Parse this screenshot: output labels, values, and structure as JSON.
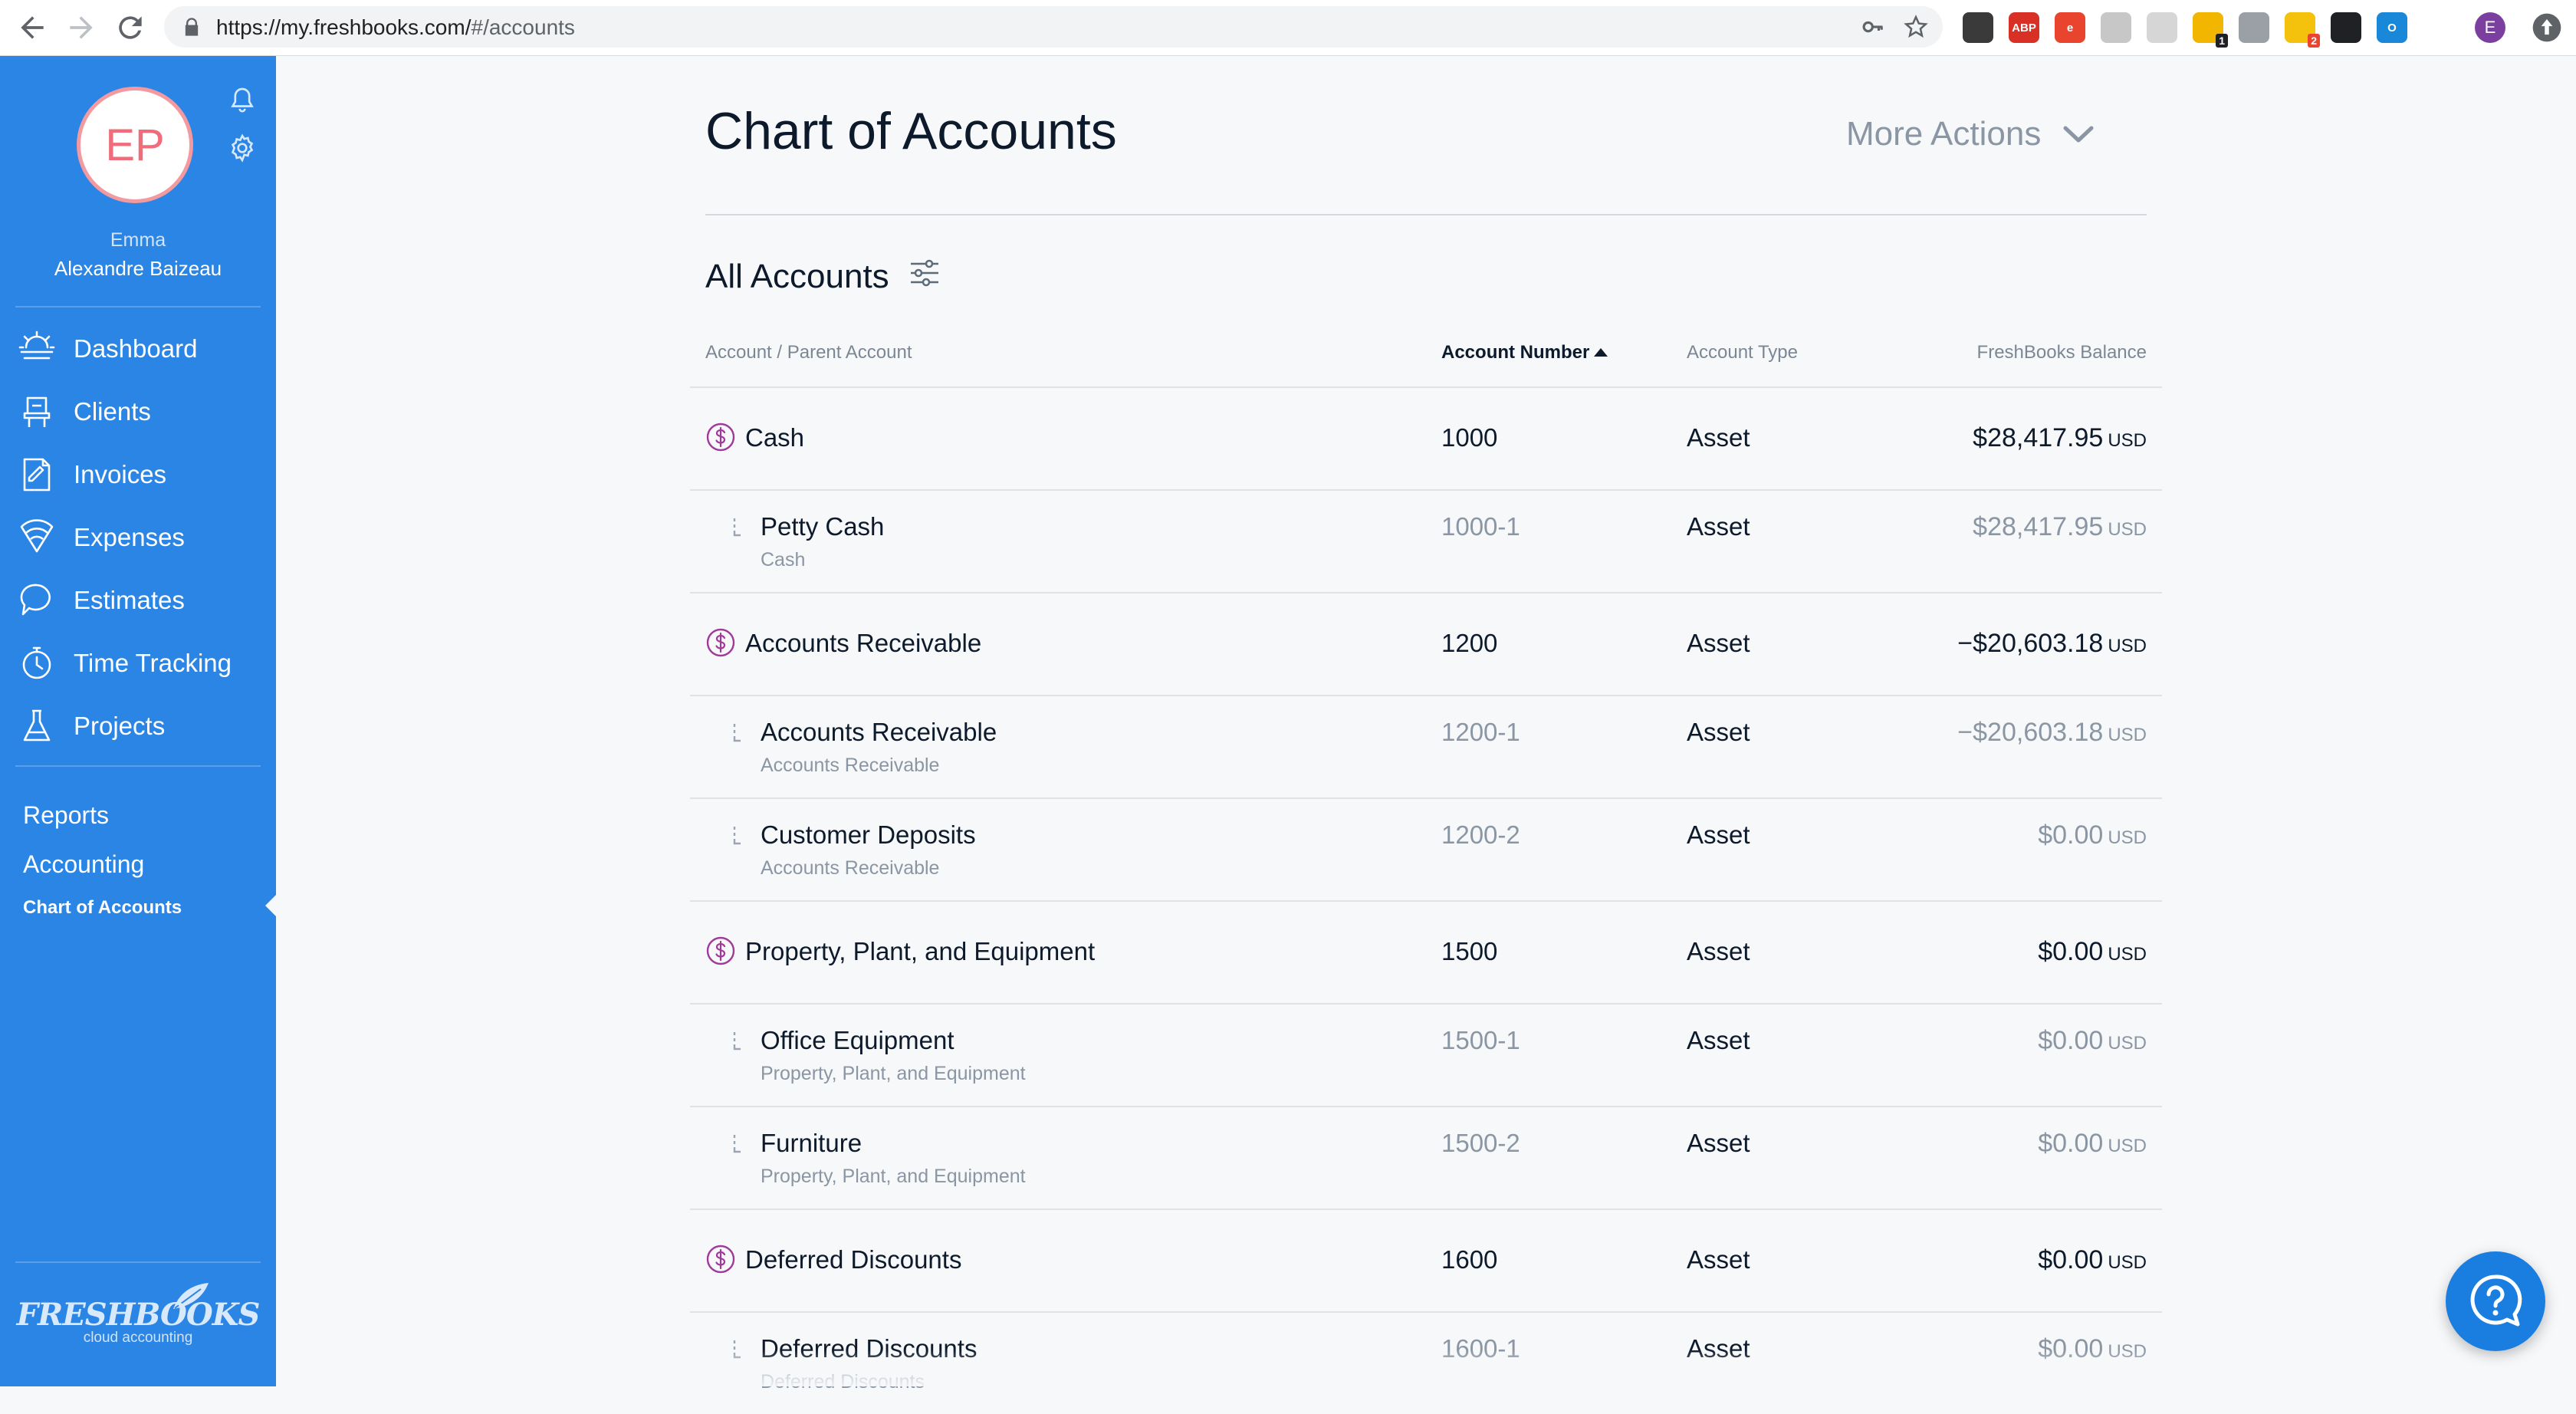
{
  "browser": {
    "url_host": "https://my.freshbooks.com/",
    "url_path": "#/accounts",
    "extensions": [
      {
        "name": "pocket-icon",
        "color": "#3a3a3a",
        "label": ""
      },
      {
        "name": "adblock-icon",
        "color": "#d93025",
        "label": "ABP"
      },
      {
        "name": "e-extension-icon",
        "color": "#e8442e",
        "label": "e"
      },
      {
        "name": "tag-icon",
        "color": "#c7c7c7",
        "label": ""
      },
      {
        "name": "grid-icon",
        "color": "#d6d6d6",
        "label": ""
      },
      {
        "name": "sticky-note-icon",
        "color": "#f2b500",
        "label": "",
        "badge": "1"
      },
      {
        "name": "briefcase-icon",
        "color": "#9aa0a6",
        "label": ""
      },
      {
        "name": "bulb-icon",
        "color": "#f4c20d",
        "label": "",
        "badge": "2"
      },
      {
        "name": "camera-icon",
        "color": "#202124",
        "label": ""
      },
      {
        "name": "circle-o-icon",
        "color": "#1a88d8",
        "label": "O"
      }
    ],
    "profile_initial": "E"
  },
  "sidebar": {
    "avatar_initials": "EP",
    "user_first": "Emma",
    "user_last": "Alexandre Baizeau",
    "nav": [
      {
        "label": "Dashboard",
        "icon": "dashboard-icon"
      },
      {
        "label": "Clients",
        "icon": "clients-icon"
      },
      {
        "label": "Invoices",
        "icon": "invoices-icon"
      },
      {
        "label": "Expenses",
        "icon": "expenses-icon"
      },
      {
        "label": "Estimates",
        "icon": "estimates-icon"
      },
      {
        "label": "Time Tracking",
        "icon": "time-tracking-icon"
      },
      {
        "label": "Projects",
        "icon": "projects-icon"
      }
    ],
    "reports": "Reports",
    "accounting": "Accounting",
    "chart_of_accounts": "Chart of Accounts",
    "logo_wordmark": "FRESHBOOKS",
    "logo_tagline": "cloud accounting"
  },
  "main": {
    "title": "Chart of Accounts",
    "more_actions": "More Actions",
    "section_title": "All Accounts",
    "columns": {
      "account": "Account / Parent Account",
      "number": "Account Number",
      "type": "Account Type",
      "balance": "FreshBooks Balance"
    },
    "rows": [
      {
        "kind": "parent",
        "name": "Cash",
        "number": "1000",
        "type": "Asset",
        "balance": "$28,417.95",
        "currency": "USD"
      },
      {
        "kind": "sub",
        "name": "Petty Cash",
        "parent": "Cash",
        "number": "1000-1",
        "type": "Asset",
        "balance": "$28,417.95",
        "currency": "USD"
      },
      {
        "kind": "parent",
        "name": "Accounts Receivable",
        "number": "1200",
        "type": "Asset",
        "balance": "−$20,603.18",
        "currency": "USD"
      },
      {
        "kind": "sub",
        "name": "Accounts Receivable",
        "parent": "Accounts Receivable",
        "number": "1200-1",
        "type": "Asset",
        "balance": "−$20,603.18",
        "currency": "USD"
      },
      {
        "kind": "sub",
        "name": "Customer Deposits",
        "parent": "Accounts Receivable",
        "number": "1200-2",
        "type": "Asset",
        "balance": "$0.00",
        "currency": "USD"
      },
      {
        "kind": "parent",
        "name": "Property, Plant, and Equipment",
        "number": "1500",
        "type": "Asset",
        "balance": "$0.00",
        "currency": "USD"
      },
      {
        "kind": "sub",
        "name": "Office Equipment",
        "parent": "Property, Plant, and Equipment",
        "number": "1500-1",
        "type": "Asset",
        "balance": "$0.00",
        "currency": "USD"
      },
      {
        "kind": "sub",
        "name": "Furniture",
        "parent": "Property, Plant, and Equipment",
        "number": "1500-2",
        "type": "Asset",
        "balance": "$0.00",
        "currency": "USD"
      },
      {
        "kind": "parent",
        "name": "Deferred Discounts",
        "number": "1600",
        "type": "Asset",
        "balance": "$0.00",
        "currency": "USD"
      },
      {
        "kind": "sub",
        "name": "Deferred Discounts",
        "parent": "Deferred Discounts",
        "number": "1600-1",
        "type": "Asset",
        "balance": "$0.00",
        "currency": "USD"
      }
    ]
  },
  "colors": {
    "sidebar": "#2b85e5",
    "accent_purple": "#a0399a",
    "avatar_ring": "#f39aa0",
    "help_button": "#1a7ee0"
  }
}
